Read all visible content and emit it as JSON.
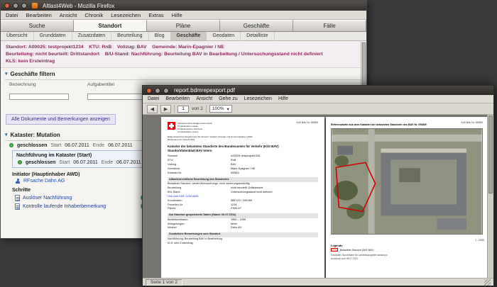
{
  "colors": {
    "info_text": "#8b2a5a",
    "accent_blue": "#2e6e9e",
    "status_green": "#3fae3f",
    "swiss_red": "#e30613",
    "kbs_red": "#d00000"
  },
  "firefox": {
    "title": "Altlast4Web - Mozilla Firefox",
    "menu": [
      "Datei",
      "Bearbeiten",
      "Ansicht",
      "Chronik",
      "Lesezeichen",
      "Extras",
      "Hilfe"
    ],
    "main_tabs": [
      {
        "label": "Suche"
      },
      {
        "label": "Standort",
        "active": true
      },
      {
        "label": "Pläne"
      },
      {
        "label": "Geschäfte"
      },
      {
        "label": "Fälle"
      }
    ],
    "sub_tabs": [
      {
        "label": "Übersicht"
      },
      {
        "label": "Grunddaten"
      },
      {
        "label": "Zusatzdaten"
      },
      {
        "label": "Beurteilung"
      },
      {
        "label": "Blog"
      },
      {
        "label": "Geschäfte",
        "active": true
      },
      {
        "label": "Geodaten"
      },
      {
        "label": "Detailliste"
      }
    ],
    "info_lines": [
      "Standort: A00025: testprojekt1234    KTU: RnB    Vollzug: BAV    Gemeinde: Marin-Epagnier / NE",
      "Beurteilung: nicht beurteilt: Drittstandort    B/U-Stand: Nachführung: Beurteilung BAV in Bearbeitung / Untersuchungsstand nicht definiert",
      "KLS: kein Ersteintrag"
    ],
    "filter": {
      "title": "Geschäfte filtern",
      "fields": [
        {
          "label": "Bezeichnung"
        },
        {
          "label": "Aufgabentitel"
        }
      ]
    },
    "docs_link": "Alle Dokumente und Bemerkungen anzeigen",
    "kataster": {
      "title": "Kataster: Mutation",
      "status": "geschlossen",
      "start_label": "Start",
      "start_date": "06.07.2011",
      "end_label": "Ende",
      "end_date": "06.07.2011",
      "sub_title": "Nachführung im Kataster (Start)",
      "sub_status": "geschlossen",
      "initiator_label": "Initiator (Hauptinhaber AWD)",
      "initiator_name": "RFsache Dahn AG",
      "steps_label": "Schritte",
      "steps": [
        {
          "label": "Auslöser Nachführung"
        },
        {
          "label": "Kontrolle laufende Inhaberbemerkung"
        }
      ]
    }
  },
  "pdf": {
    "title": "report.bdmrepexport.pdf",
    "menu": [
      "Datei",
      "Bearbeiten",
      "Ansicht",
      "Gehe zu",
      "Lesezeichen",
      "Hilfe"
    ],
    "toolbar": {
      "back_icon": "◀",
      "forward_icon": "▶",
      "page_value": "1",
      "pages_label": "von 2",
      "zoom_value": "100%"
    },
    "status": "Seite 1 von 2",
    "page1": {
      "ref": "KbS BAV Nr. 0538/9",
      "logo_lines": [
        "Schweizerische Eidgenossenschaft",
        "Confédération suisse",
        "Confederazione Svizzera",
        "Confederaziun svizra"
      ],
      "dept_lines": [
        "Eidgenössisches Departement für Umwelt, Verkehr, Energie und Kommunikation UVEK",
        "Bundesamt für Verkehr BAV"
      ],
      "title_lines": [
        "Kataster der belasteten Standorte des Bundesamtes für Verkehr (KbS BAV)",
        "Standortdatenblatt BAV Intern"
      ],
      "rows": [
        {
          "type": "kv",
          "label": "Standort",
          "value": "A00025: testprojekt1234"
        },
        {
          "type": "kv",
          "label": "KTU",
          "value": "RnB"
        },
        {
          "type": "kv",
          "label": "Vollzug",
          "value": "BAV"
        },
        {
          "type": "kv",
          "label": "Gemeinde",
          "value": "Marin-Epagnier / NE"
        },
        {
          "type": "kv",
          "label": "Kataster-Nr.",
          "value": "0538/9"
        },
        {
          "type": "header",
          "label": "Altlastenrechtliche Beurteilung des Standortes"
        },
        {
          "type": "text",
          "label": "Belasteter Standort, weder überwachungs- noch sanierungsbedürftig"
        },
        {
          "type": "kv",
          "label": "Beurteilung",
          "value": "nicht beurteilt: Drittstandort"
        },
        {
          "type": "kv",
          "label": "B/U-Stand",
          "value": "Untersuchungsstand nicht definiert"
        },
        {
          "type": "link",
          "label": "Link zum KbS: 1234 AWD"
        },
        {
          "type": "kv",
          "label": "Koordinaten",
          "value": "565'123 / 205'456"
        },
        {
          "type": "kv",
          "label": "Parzellen-Nr.",
          "value": "1234"
        },
        {
          "type": "kv",
          "label": "Fläche",
          "value": "2'500 m²"
        },
        {
          "type": "header",
          "label": "Am Standort gespeicherte Daten (Stand: 06.07.2011)"
        },
        {
          "type": "kv",
          "label": "Betriebszeitraum",
          "value": "1950 – 1999"
        },
        {
          "type": "kv",
          "label": "Ablagerungen",
          "value": "keine"
        },
        {
          "type": "kv",
          "label": "Inhaber",
          "value": "Dahn AG"
        },
        {
          "type": "header",
          "label": "Zusätzliche Bemerkungen zum Standort"
        },
        {
          "type": "text",
          "label": "Nachführung: Beurteilung BAV in Bearbeitung"
        },
        {
          "type": "text",
          "label": "KLS: kein Ersteintrag"
        }
      ]
    },
    "page2": {
      "ref": "KbS BAV Nr. 0538/9",
      "title": "Referenzkarte aus dem Kataster der belasteten Standorte des BAV Nr. 0538/9",
      "scale": "1 : 2'000",
      "legend_title": "Legende",
      "legend_items": [
        {
          "label": "Belasteter Standort (KbS BAV)"
        }
      ],
      "footnotes": [
        "Geodaten: Bundesamt für Landestopografie swisstopo",
        "Ausdruck vom 06.07.2011"
      ]
    }
  }
}
